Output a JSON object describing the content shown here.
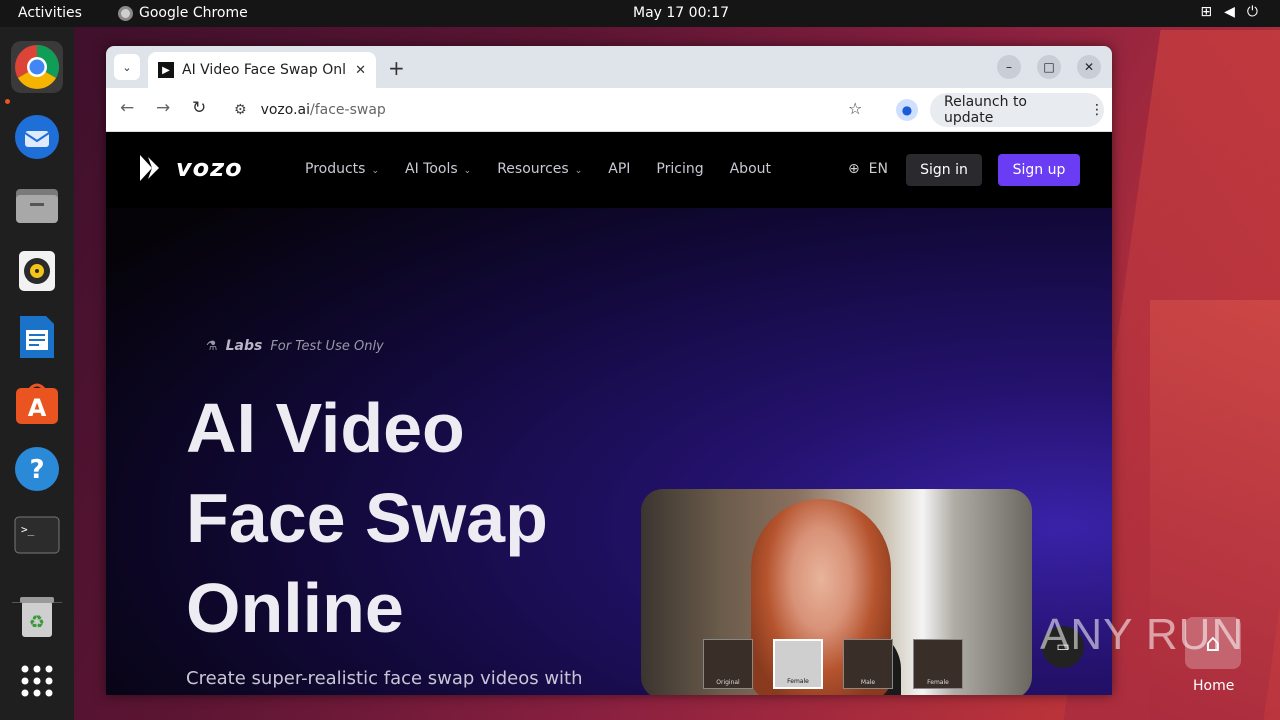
{
  "topbar": {
    "activities": "Activities",
    "app_name": "Google Chrome",
    "clock": "May 17  00:17"
  },
  "dock": {
    "items": [
      {
        "name": "chrome",
        "icon": "chrome-icon"
      },
      {
        "name": "thunderbird",
        "icon": "thunderbird-icon"
      },
      {
        "name": "files",
        "icon": "files-icon"
      },
      {
        "name": "rhythmbox",
        "icon": "rhythmbox-icon"
      },
      {
        "name": "writer",
        "icon": "writer-icon"
      },
      {
        "name": "app-center",
        "icon": "app-center-icon"
      },
      {
        "name": "help",
        "icon": "help-icon"
      },
      {
        "name": "terminal",
        "icon": "terminal-icon"
      },
      {
        "name": "trash",
        "icon": "trash-icon"
      },
      {
        "name": "show-apps",
        "icon": "grid-icon"
      }
    ]
  },
  "browser": {
    "tab_title": "AI Video Face Swap Onli",
    "url_host": "vozo.ai",
    "url_path": "/face-swap",
    "relaunch_label": "Relaunch to update"
  },
  "site": {
    "logo": "vozo",
    "menu": [
      "Products",
      "AI Tools",
      "Resources",
      "API",
      "Pricing",
      "About"
    ],
    "menu_has_dropdown": [
      true,
      true,
      true,
      false,
      false,
      false
    ],
    "lang": "EN",
    "signin": "Sign in",
    "signup": "Sign up",
    "labs_brand": "Labs",
    "labs_note": "For Test Use Only",
    "hero_line1": "AI Video",
    "hero_line2": "Face Swap",
    "hero_line3": "Online",
    "subtitle": "Create super-realistic face swap videos with",
    "thumbs": [
      "Original",
      "Female",
      "Male",
      "Female"
    ],
    "accent": "#6a3df5"
  },
  "desktop": {
    "home_label": "Home",
    "watermark": "ANY RUN"
  }
}
